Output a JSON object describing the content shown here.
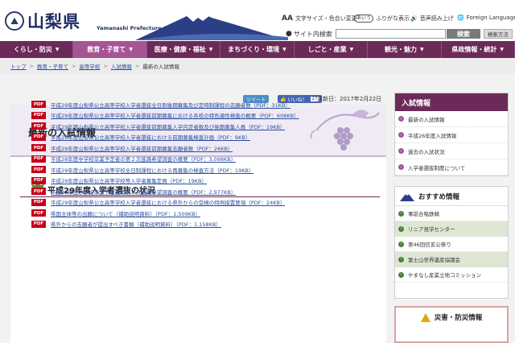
{
  "header": {
    "logo_kanji": "山梨県",
    "logo_en": "Yamanashi Prefecture",
    "util": {
      "font_size": "文字サイズ・色合い変更",
      "furigana": "ふりがな表示",
      "speech": "音声読み上げ",
      "foreign": "Foreign Language",
      "font_icon": "AA",
      "furigana_icon": "あいう",
      "speech_icon": "🔊",
      "foreign_icon": "🌐"
    },
    "search": {
      "label": "サイト内検索",
      "placeholder": "",
      "button": "検索",
      "detail": "検索方法"
    }
  },
  "nav": [
    {
      "label": "くらし・防災"
    },
    {
      "label": "教育・子育て"
    },
    {
      "label": "医療・健康・福祉"
    },
    {
      "label": "まちづくり・環境"
    },
    {
      "label": "しごと・産業"
    },
    {
      "label": "観光・魅力"
    },
    {
      "label": "県政情報・統計"
    }
  ],
  "breadcrumb": {
    "items": [
      "トップ",
      "教育・子育て",
      "高等学校",
      "入試情報"
    ],
    "current": "最新の入試情報",
    "sep": ">"
  },
  "share": {
    "tweet": "ツイート",
    "like": "いいね！",
    "like_count": "27",
    "updated": "更新日：2017年2月22日"
  },
  "main": {
    "page_title": "最新の入試情報",
    "section_title": "平成29年度入学者選抜の状況",
    "pdf_badge": "PDF",
    "links": [
      "平成29年度山梨県公立高等学校入学者選抜全日制後期募集及び定時制課程の志願者数（PDF：31KB）",
      "平成29年度山梨県公立高等学校入学者選抜前期募集における各校の特色適性検査の概要（PDF：608KB）",
      "平成29年度山梨県公立高等学校入学者選抜前期募集入学内定者数及び後期募集人員（PDF：19KB）",
      "平成29年度山梨県公立高等学校入学者選抜における前期募集検査計画（PDF：9KB）",
      "平成29年度山梨県公立高等学校入学者選抜前期募集志願者数（PDF：26KB）",
      "平成28年度中学校卒業予定者の第２次進路希望調査の概要（PDF：3,098KB）",
      "平成29年度山梨県公立高等学校全日制課程における再募集の検査方法（PDF：19KB）",
      "平成29年度山梨県公立高等学校等入学者募集定員（PDF：19KB）",
      "平成28年度中学校卒業予定者の第１次進路希望調査の概要（PDF：2,977KB）",
      "平成29年度山梨県公立高等学校入学者選抜における県外からの受検の特例措置要項（PDF：24KB）",
      "県国主体等の出願について（補助説明資料）（PDF：1,509KB）",
      "県外からの志願者が提出すべき書類（補助説明資料）（PDF：1,158KB）"
    ]
  },
  "sidebar": {
    "heading": "入試情報",
    "items": [
      "最新の入試情報",
      "平成26年度入試情報",
      "過去の入試状況",
      "入学者選抜制度について"
    ],
    "rec_heading": "おすすめ情報",
    "rec_items": [
      "事前合唱鉄騎",
      "リニア見学センター",
      "第46回信玄公祭り",
      "富士山世界遺産協議会",
      "やまなし産業立地コミッション"
    ],
    "disaster": "災害・防災情報",
    "arrow": "›"
  },
  "colors": {
    "nav_bg": "#6b2a57",
    "nav_active": "#a65594",
    "pdf_red": "#c4001a",
    "link_blue": "#2a4fa0"
  }
}
